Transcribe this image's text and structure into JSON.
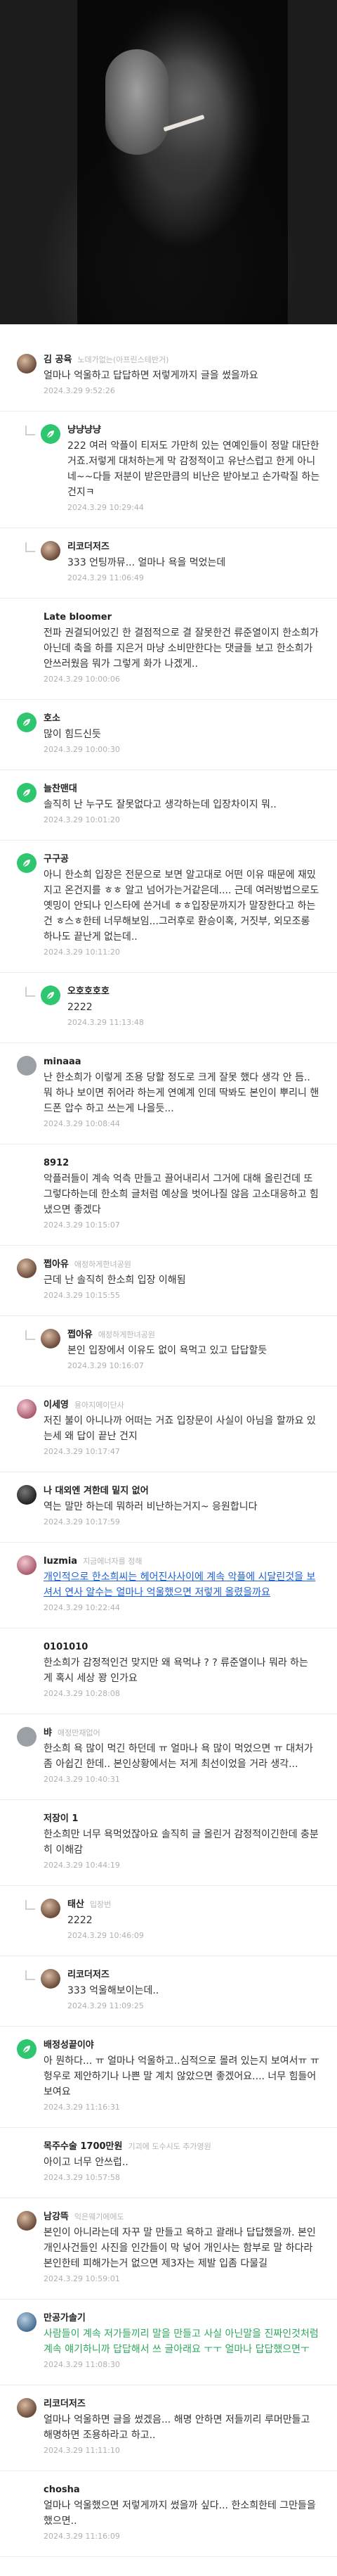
{
  "comments": [
    {
      "nick": "김 공육",
      "ident": "노데가없는(아프린스테반거)",
      "body": "얼마나 억울하고 답답하면 저렇게까지 글을 썼을까요",
      "date": "2024.3.29 9:52:26",
      "avatar": "photo",
      "reply": false
    },
    {
      "nick": "냥냥냥냥",
      "ident": "",
      "body": "222 여러 악플이 티저도 가만히 있는 연예인들이 정말 대단한거죠.저렇게 대처하는게 막 감정적이고 유난스럽고 한게 아니네~~다들 저분이 받은만큼의 비난은 받아보고 손가락질 하는건지ㅋ",
      "date": "2024.3.29 10:29:44",
      "avatar": "green",
      "reply": true
    },
    {
      "nick": "리코더저즈",
      "ident": "",
      "body": "333 언팅까뮤... 얼마나 욕을 먹었는데",
      "date": "2024.3.29 11:06:49",
      "avatar": "photo",
      "reply": true
    },
    {
      "nick": "Late bloomer",
      "ident": "",
      "body": "전파 권결되어있긴 한 결점적으로 결 잘못한건 류준열이지 한소희가 아닌데 축을 하를 지은거 마냥 소비만한다는 댓글들 보고 한소희가 안쓰러웠음 뭐가 그렇게 화가 나겠게..",
      "date": "2024.3.29 10:00:06",
      "avatar": "none",
      "reply": false
    },
    {
      "nick": "호소",
      "ident": "",
      "body": "많이 힘드신듯",
      "date": "2024.3.29 10:00:30",
      "avatar": "green",
      "reply": false
    },
    {
      "nick": "늘찬맨대",
      "ident": "",
      "body": "솔직히 난 누구도 잘못없다고 생각하는데 입장차이지 뭐..",
      "date": "2024.3.29 10:01:20",
      "avatar": "green",
      "reply": false
    },
    {
      "nick": "구구공",
      "ident": "",
      "body": "아니 한소희 입장은 전문으로 보면 알고대로 어떤 이유 때문에 재밌지고 온건지를 ㅎㅎ 알고 넘어가는거같은데.... 근데 여러방법으로도 옛밍이 안되나 인스타에 쓴거네 ㅎㅎ입장문까지가 말장한다고 하는건 ㅎ스ㅎ한테 너무해보임...그러후로 환승이혹, 거짓부, 외모조롱 하나도 끝난게 없는데..",
      "date": "2024.3.29 10:11:20",
      "avatar": "green",
      "reply": false
    },
    {
      "nick": "오호호호호",
      "ident": "",
      "body": "2222",
      "date": "2024.3.29 11:13:48",
      "avatar": "green",
      "reply": true
    },
    {
      "nick": "minaaa",
      "ident": "",
      "body": "난 한소희가 이렇게 조용 당할 정도로 크게 잘못 했다 생각 안 듬.. 뭐 하나 보이면 쥐어라 하는게 연예계 인데 딱봐도 본인이 뿌리니 핸드폰 압수 하고 쓰는게 나을듯...",
      "date": "2024.3.29 10:08:44",
      "avatar": "gray",
      "reply": false
    },
    {
      "nick": "8912",
      "ident": "",
      "body": "악플러들이 계속 억측 만들고 끌어내리서 그거에 대해 올린건데 또 그렇다하는데 한소희 글처럼 예상을 벗어나질 않음 고소대응하고 힘냈으면 좋겠다",
      "date": "2024.3.29 10:15:07",
      "avatar": "none",
      "reply": false
    },
    {
      "nick": "쩝아유",
      "ident": "애정하게한녀공원",
      "body": "근데 난 솔직히 한소희 입장 이해됨",
      "date": "2024.3.29 10:15:55",
      "avatar": "photo",
      "reply": false
    },
    {
      "nick": "쩝아유",
      "ident": "애정하게한녀공원",
      "body": "본인 입장에서 이유도 없이 욕먹고 있고 답답할듯",
      "date": "2024.3.29 10:16:07",
      "avatar": "photo",
      "reply": true
    },
    {
      "nick": "이세영",
      "ident": "용아지에이단사",
      "body": "저진 불이 아니나까 어떠는 거죠 입장문이 사실이 아님을 할까요 있는세 왜 답이 끝난 건지",
      "date": "2024.3.29 10:17:47",
      "avatar": "pink",
      "reply": false
    },
    {
      "nick": "나 대외엔 겨한데 밑지 없어",
      "ident": "",
      "body": "역는 말만 하는데 뭐하러 비난하는거지~ 응원합니다",
      "date": "2024.3.29 10:17:59",
      "avatar": "dark",
      "reply": false
    },
    {
      "nick": "luzmia",
      "ident": "지금에너자를 정해",
      "body": "개인적으로 한소희씨는 헤어진사사이에 계속 악플에 시달린것을 보셔서 연사 알수는 얼마나 억울했으면 저렇게 올렸을까요",
      "date": "2024.3.29 10:22:44",
      "avatar": "pink",
      "reply": false,
      "link": true
    },
    {
      "nick": "0101010",
      "ident": "",
      "body": "한소희가 감정적인건 맞지만 왜 욕먹냐 ? ? 류준열이나 뭐라 하는 게 혹시 세상 꽝 인가요",
      "date": "2024.3.29 10:28:08",
      "avatar": "none",
      "reply": false
    },
    {
      "nick": "뱌",
      "ident": "애정만재없어",
      "body": "한소희 욕 많이 먹긴 하던데 ㅠ 얼마나 욕 많이 먹었으면 ㅠ 대처가 좀 아쉽긴 한데.. 본인상황에서는 저게 최선이었을 거라 생각...",
      "date": "2024.3.29 10:40:31",
      "avatar": "gray",
      "reply": false
    },
    {
      "nick": "저장이 1",
      "ident": "",
      "body": "한소희만 너무 욕먹었잖아요 솔직히 글 올린거 감정적이긴한데 충분히 이해감",
      "date": "2024.3.29 10:44:19",
      "avatar": "none",
      "reply": false
    },
    {
      "nick": "태산",
      "ident": "입장번",
      "body": "2222",
      "date": "2024.3.29 10:46:09",
      "avatar": "photo",
      "reply": true
    },
    {
      "nick": "리코더저즈",
      "ident": "",
      "body": "333 억울해보이는데..",
      "date": "2024.3.29 11:09:25",
      "avatar": "photo",
      "reply": true
    },
    {
      "nick": "배정성끝이야",
      "ident": "",
      "body": "아 뭔하다... ㅠ 얼마나 억울하고..심적으로 몰려 있는지 보여서ㅠ ㅠ 헝우로 제안하기나 나쁜 말 계치 않았으면 좋겠어요.... 너무 힘들어 보여요",
      "date": "2024.3.29 11:16:31",
      "avatar": "green",
      "reply": false
    },
    {
      "nick": "목주수술 1700만원",
      "ident": "기괴에 도수시도 추가영원",
      "body": "아이고 너무 안쓰럽..",
      "date": "2024.3.29 10:57:58",
      "avatar": "none",
      "reply": false
    },
    {
      "nick": "남강뜩",
      "ident": "익은웨기에에도",
      "body": "본인이 아니라는데 자꾸 말 만들고 욕하고 괄래나 답답했을까. 본인 개인사건들인 사진을 인간들이 막 넣어 개인사는 함부로 말 하다라 본인한테 피해가는거 없으면 제3자는 제발 입좀 다물길",
      "date": "2024.3.29 10:59:01",
      "avatar": "photo",
      "reply": false
    },
    {
      "nick": "만공가솔기",
      "ident": "",
      "body": "사람들이 계속 저가들끼리 말을 만들고 사실 아닌말을 진짜인것처럼 계속 얘기하니까 답답해서 쓰 글아래요 ㅜㅜ 얼마나 답답했으면ㅜ",
      "date": "2024.3.29 11:08:30",
      "avatar": "blue",
      "reply": false,
      "green": true
    },
    {
      "nick": "리코더저즈",
      "ident": "",
      "body": "얼마나 억울하면 글을 썼겠음... 해명 안하면 저들끼리 루머만들고 해명하면 조용하라고 하고..",
      "date": "2024.3.29 11:11:10",
      "avatar": "photo",
      "reply": false
    },
    {
      "nick": "chosha",
      "ident": "",
      "body": "얼마나 억울했으면 저렇게까지 썼을까 싶다... 한소희한테 그만들을 했으면..",
      "date": "2024.3.29 11:16:09",
      "avatar": "none",
      "reply": false
    }
  ]
}
